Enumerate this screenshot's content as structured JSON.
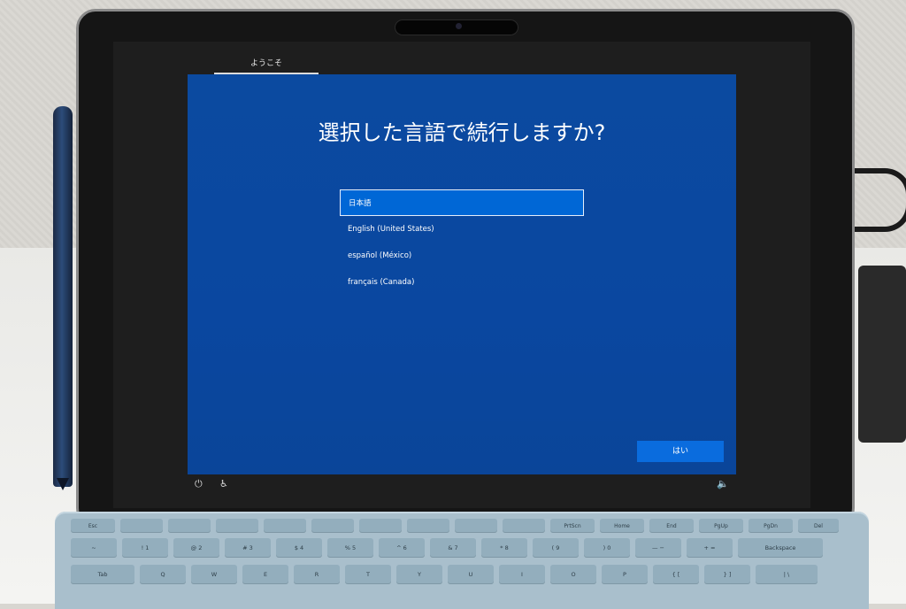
{
  "oobe": {
    "tab": "ようこそ",
    "heading": "選択した言語で続行しますか?",
    "languages": [
      "日本語",
      "English (United States)",
      "español (México)",
      "français (Canada)"
    ],
    "selected_index": 0,
    "yes_button": "はい"
  },
  "status_bar": {
    "left_icons": [
      "power-icon",
      "accessibility-icon"
    ],
    "right_icons": [
      "volume-icon"
    ]
  },
  "keyboard": {
    "fn_row": [
      "Esc",
      "",
      "",
      "",
      "",
      "",
      "",
      "",
      "",
      "",
      "PrtScn",
      "Home",
      "End",
      "PgUp",
      "PgDn",
      "Del"
    ],
    "number_row": [
      "~",
      "!\n1",
      "@\n2",
      "#\n3",
      "$\n4",
      "%\n5",
      "^\n6",
      "&\n7",
      "*\n8",
      "(\n9",
      ")\n0",
      "—\n−",
      "+\n=",
      "Backspace"
    ],
    "top_row": [
      "Tab",
      "Q",
      "W",
      "E",
      "R",
      "T",
      "Y",
      "U",
      "I",
      "O",
      "P",
      "{\n[",
      "}\n]",
      "|\n\\"
    ]
  },
  "colors": {
    "panel": "#0a47a0",
    "selected": "#0067d6",
    "button": "#0a6cde"
  }
}
